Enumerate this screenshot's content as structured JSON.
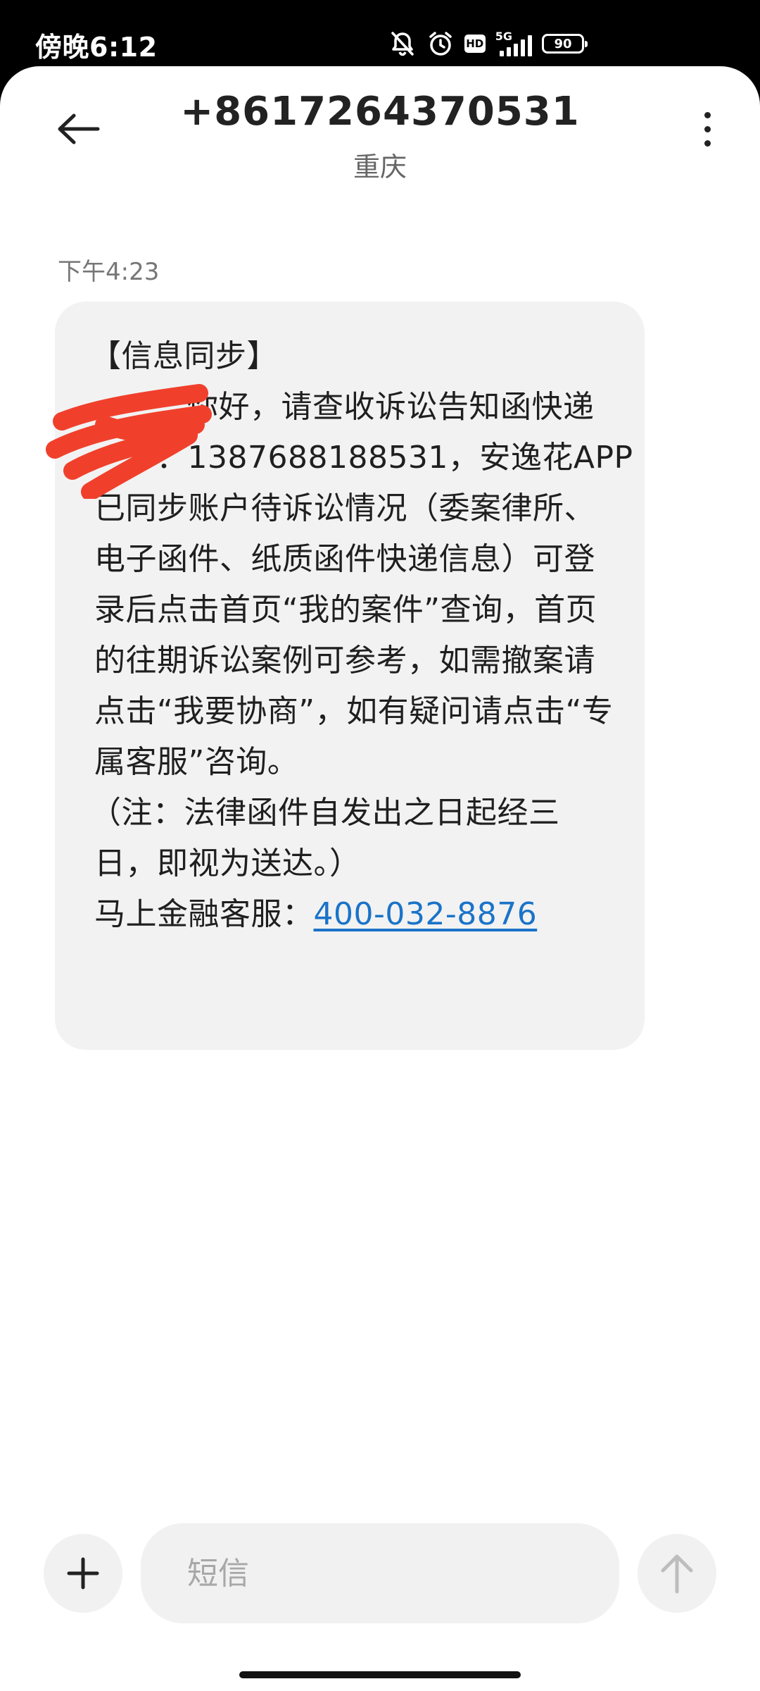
{
  "status_bar": {
    "time": "傍晚6:12",
    "network": "5G",
    "hd_label": "HD",
    "battery": "90"
  },
  "header": {
    "title": "+8617264370531",
    "subtitle": "重庆"
  },
  "conversation": {
    "timestamp": "下午4:23",
    "message_lines": [
      "【信息同步】",
      "你好，请查收诉讼告知函快递",
      "：1387688188531，安逸花APP",
      "已同步账户待诉讼情况（委案律所、",
      "电子函件、纸质函件快递信息）可登",
      "录后点击首页“我的案件”查询，首页",
      "的往期诉讼案例可参考，如需撤案请",
      "点击“我要协商”，如有疑问请点击“专",
      "属客服”咨询。",
      "（注：法律函件自发出之日起经三",
      "日，即视为送达。）"
    ],
    "service_label": "马上金融客服：",
    "service_phone": "400-032-8876",
    "redaction_color": "#f0402c"
  },
  "composer": {
    "placeholder": "短信"
  }
}
